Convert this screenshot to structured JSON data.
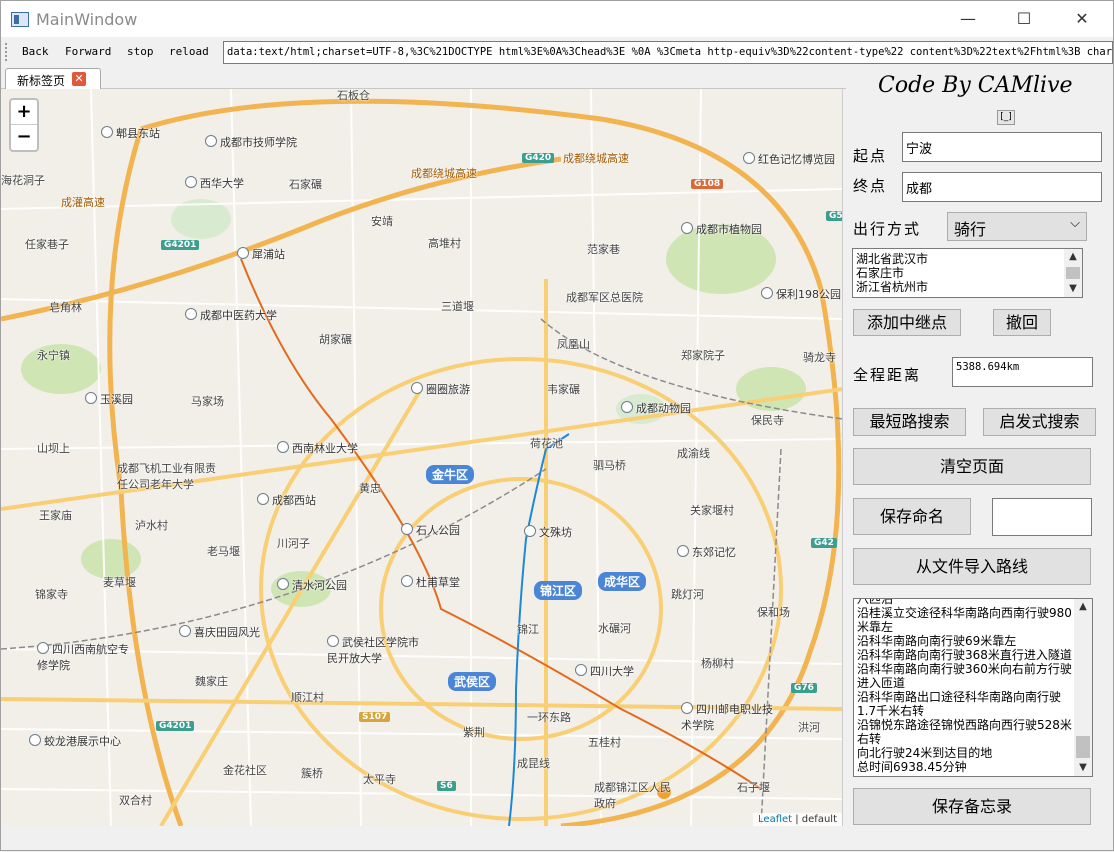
{
  "window": {
    "title": "MainWindow",
    "minimize": "—",
    "maximize": "☐",
    "close": "✕"
  },
  "toolbar": {
    "back": "Back",
    "forward": "Forward",
    "stop": "stop",
    "reload": "reload",
    "url": "data:text/html;charset=UTF-8,%3C%21DOCTYPE html%3E%0A%3Chead%3E    %0A    %3Cmeta http-equiv%3D%22content-type%22 content%3D%22text%2Fhtml%3B charset"
  },
  "tab": {
    "label": "新标签页",
    "close": "✕"
  },
  "map": {
    "zoom_in": "+",
    "zoom_out": "−",
    "attribution_link": "Leaflet",
    "attribution_rest": " | default",
    "districts": [
      "金牛区",
      "锦江区",
      "成华区",
      "武侯区"
    ],
    "shields": [
      "G4201",
      "G420",
      "G108",
      "G42",
      "G76",
      "S107",
      "S6",
      "G5",
      "G4201"
    ],
    "labels": [
      "石板仓",
      "成都绕城高速",
      "成都绕城高速",
      "红色记忆博览园",
      "西华大学",
      "石家碾",
      "海花洞子",
      "成灌高速",
      "安靖",
      "任家巷子",
      "高堆村",
      "范家巷",
      "成都市植物园",
      "犀浦站",
      "皂角林",
      "三道堰",
      "成都军区总医院",
      "保利198公园",
      "成都中医药大学",
      "胡家碾",
      "凤凰山",
      "郑家院子",
      "骑龙寺",
      "永宁镇",
      "圈圈旅游",
      "韦家碾",
      "玉溪园",
      "马家场",
      "成都动物园",
      "保民寺",
      "西南林业大学",
      "荷花池",
      "成渝线",
      "山坝上",
      "驷马桥",
      "成都飞机工业有限责任公司老年大学",
      "黄忠",
      "成都西站",
      "王家庙",
      "泸水村",
      "石人公园",
      "文殊坊",
      "关家堰村",
      "老马堰",
      "川河子",
      "东郊记忆",
      "清水河公园",
      "杜甫草堂",
      "麦草堰",
      "跳灯河",
      "锦家寺",
      "喜庆田园风光",
      "锦江",
      "水碾河",
      "保和场",
      "四川西南航空专修学院",
      "武侯社区学院市民开放大学",
      "四川大学",
      "杨柳村",
      "魏家庄",
      "顺江村",
      "紫荆",
      "一环东路",
      "四川邮电职业技术学院",
      "蛟龙港展示中心",
      "五桂村",
      "洪河",
      "金花社区",
      "簇桥",
      "太平寺",
      "成昆线",
      "双合村",
      "成都锦江区人民政府",
      "石子堰",
      "郫县东站",
      "成都市技师学院"
    ]
  },
  "side": {
    "brand": "Code By CAMlive",
    "tiny_button": "[_]",
    "start_label": "起点",
    "start_value": "宁波",
    "end_label": "终点",
    "end_value": "成都",
    "mode_label": "出行方式",
    "mode_value": "骑行",
    "waypoints": [
      "湖北省武汉市",
      "石家庄市",
      "浙江省杭州市"
    ],
    "add_waypoint": "添加中继点",
    "undo": "撤回",
    "distance_label": "全程距离",
    "distance_value": "5388.694km",
    "shortest_search": "最短路搜索",
    "heuristic_search": "启发式搜索",
    "clear_page": "清空页面",
    "save_name": "保存命名",
    "save_name_value": "",
    "import_route": "从文件导入路线",
    "route_lines": [
      "八匹泊",
      "沿桂溪立交途径科华南路向西南行驶980",
      "米靠左",
      "沿科华南路向南行驶69米靠左",
      "沿科华南路向南行驶368米直行进入隧道",
      "沿科华南路向南行驶360米向右前方行驶",
      "进入匝道",
      "沿科华南路出口途径科华南路向南行驶",
      "1.7千米右转",
      "沿锦悦东路途径锦悦西路向西行驶528米",
      "右转",
      "向北行驶24米到达目的地",
      "总时间6938.45分钟"
    ],
    "save_memo": "保存备忘录"
  }
}
